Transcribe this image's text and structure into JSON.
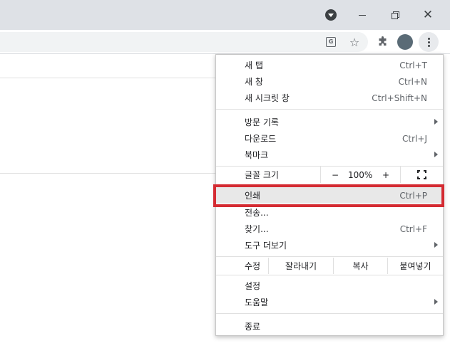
{
  "toolbar": {
    "translate_glyph": "G"
  },
  "menu": {
    "new_tab": {
      "label": "새 탭",
      "shortcut": "Ctrl+T"
    },
    "new_window": {
      "label": "새 창",
      "shortcut": "Ctrl+N"
    },
    "incognito": {
      "label": "새 시크릿 창",
      "shortcut": "Ctrl+Shift+N"
    },
    "history": {
      "label": "방문 기록"
    },
    "downloads": {
      "label": "다운로드",
      "shortcut": "Ctrl+J"
    },
    "bookmarks": {
      "label": "북마크"
    },
    "zoom": {
      "label": "글꼴 크기",
      "minus": "−",
      "value": "100%",
      "plus": "+"
    },
    "print": {
      "label": "인쇄",
      "shortcut": "Ctrl+P"
    },
    "cast": {
      "label": "전송..."
    },
    "find": {
      "label": "찾기...",
      "shortcut": "Ctrl+F"
    },
    "more_tools": {
      "label": "도구 더보기"
    },
    "edit": {
      "label": "수정",
      "cut": "잘라내기",
      "copy": "복사",
      "paste": "붙여넣기"
    },
    "settings": {
      "label": "설정"
    },
    "help": {
      "label": "도움말"
    },
    "exit": {
      "label": "종료"
    }
  },
  "colors": {
    "highlight_border": "#d42b32",
    "titlebar": "#dee1e6",
    "avatar": "#5a6b76"
  }
}
